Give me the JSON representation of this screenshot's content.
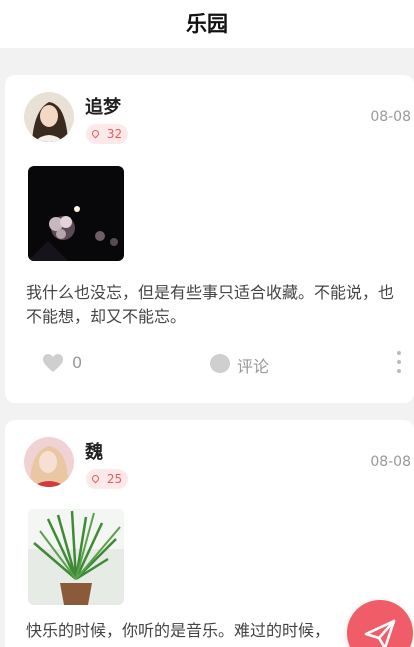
{
  "header": {
    "title": "乐园"
  },
  "posts": [
    {
      "name": "追梦",
      "badge": "32",
      "date": "08-08",
      "text": "我什么也没忘，但是有些事只适合收藏。不能说，也不能想，却又不能忘。",
      "likes": "0",
      "comment_label": "评论",
      "avatar_icon": "avatar-woman",
      "photo": "night-blossom-photo"
    },
    {
      "name": "魏",
      "badge": "25",
      "date": "08-08",
      "text": "快乐的时候，你听的是音乐。难过的时候，",
      "avatar_icon": "avatar-woman",
      "photo": "potted-orchid-photo"
    }
  ],
  "icons": {
    "like": "heart-icon",
    "comment": "comment-icon",
    "more": "more-vertical-icon",
    "location": "location-pin-icon",
    "publish": "paper-plane-icon"
  },
  "colors": {
    "accent": "#f05c67",
    "badge_bg": "#fde9e9",
    "badge_text": "#e85a5a"
  }
}
